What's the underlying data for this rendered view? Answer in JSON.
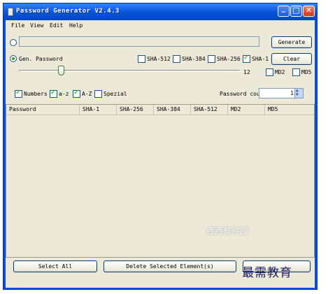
{
  "window": {
    "title": "Password Generator V2.4.3"
  },
  "menu": [
    "File",
    "View",
    "Edit",
    "Help"
  ],
  "generate_label": "Generate",
  "clear_label": "Clear",
  "gen_password_label": "Gen. Password",
  "hash_options": [
    {
      "label": "SHA-512",
      "checked": false
    },
    {
      "label": "SHA-384",
      "checked": false
    },
    {
      "label": "SHA-256",
      "checked": false
    },
    {
      "label": "SHA-1",
      "checked": true
    },
    {
      "label": "MD2",
      "checked": false
    },
    {
      "label": "MD5",
      "checked": false
    }
  ],
  "length": {
    "value": "12",
    "fraction": 0.19
  },
  "char_options": [
    {
      "label": "Numbers",
      "checked": true
    },
    {
      "label": "a-z",
      "checked": true
    },
    {
      "label": "A-Z",
      "checked": true
    },
    {
      "label": "Spezial",
      "checked": false
    }
  ],
  "password_count": {
    "label": "Password count",
    "value": "1"
  },
  "table": {
    "columns": [
      "Password",
      "SHA-1",
      "SHA-256",
      "SHA-384",
      "SHA-512",
      "MD2",
      "MD5"
    ]
  },
  "bottom": {
    "select_all": "Select All",
    "delete_selected": "Delete Selected Element(s)"
  },
  "watermark": {
    "text1": "西西软件园",
    "text2": "最需教育"
  }
}
